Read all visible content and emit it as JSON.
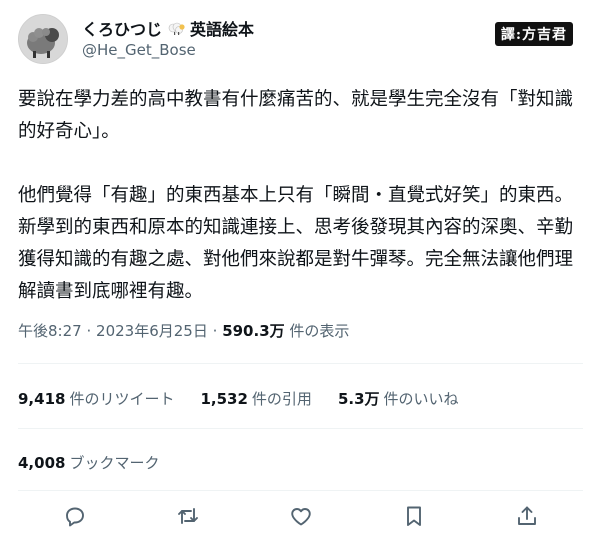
{
  "user": {
    "display_name": "くろひつじ",
    "display_suffix": "英語絵本",
    "handle": "@He_Get_Bose"
  },
  "watermark": "譯:方吉君",
  "tweet": {
    "text": "要說在學力差的高中教書有什麼痛苦的、就是學生完全沒有「對知識的好奇心」。\n\n他們覺得「有趣」的東西基本上只有「瞬間・直覺式好笑」的東西。新學到的東西和原本的知識連接上、思考後發現其內容的深奧、辛勤獲得知識的有趣之處、對他們來說都是對牛彈琴。完全無法讓他們理解讀書到底哪裡有趣。"
  },
  "meta": {
    "time": "午後8:27",
    "date": "2023年6月25日",
    "separator": "·",
    "views_count": "590.3万",
    "views_label": "件の表示"
  },
  "stats": {
    "retweets_count": "9,418",
    "retweets_label": "件のリツイート",
    "quotes_count": "1,532",
    "quotes_label": "件の引用",
    "likes_count": "5.3万",
    "likes_label": "件のいいね",
    "bookmarks_count": "4,008",
    "bookmarks_label": "ブックマーク"
  },
  "actions": {
    "icons": [
      "reply-icon",
      "retweet-icon",
      "like-icon",
      "bookmark-icon",
      "share-icon"
    ],
    "icon_color": "#536471"
  }
}
